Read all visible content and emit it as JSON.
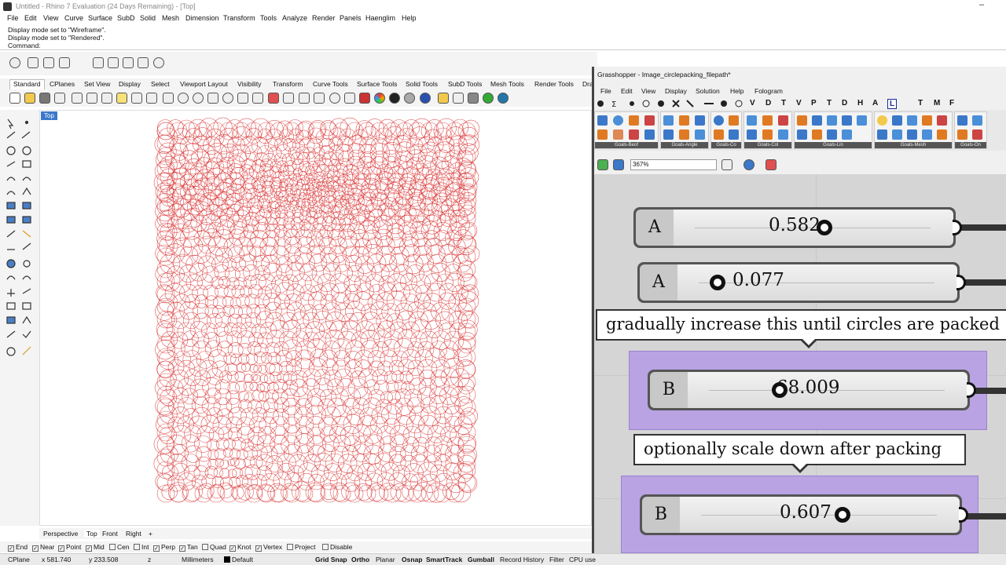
{
  "window": {
    "title": "Untitled - Rhino 7 Evaluation (24 Days Remaining) - [Top]",
    "minimize_glyph": "–"
  },
  "menubar": [
    "File",
    "Edit",
    "View",
    "Curve",
    "Surface",
    "SubD",
    "Solid",
    "Mesh",
    "Dimension",
    "Transform",
    "Tools",
    "Analyze",
    "Render",
    "Panels",
    "Haenglim",
    "Help"
  ],
  "command_history": {
    "line1": "Display mode set to \"Wireframe\".",
    "line2": "Display mode set to \"Rendered\".",
    "prompt": "Command:"
  },
  "toolbar_tabs": [
    "Standard",
    "CPlanes",
    "Set View",
    "Display",
    "Select",
    "Viewport Layout",
    "Visibility",
    "Transform",
    "Curve Tools",
    "Surface Tools",
    "Solid Tools",
    "SubD Tools",
    "Mesh Tools",
    "Render Tools",
    "Dra"
  ],
  "viewport": {
    "label": "Top",
    "tabs": [
      "Perspective",
      "Top",
      "Front",
      "Right"
    ],
    "add_tab_glyph": "+",
    "curve_color": "#d62020"
  },
  "osnaps": [
    {
      "label": "End",
      "checked": true
    },
    {
      "label": "Near",
      "checked": true
    },
    {
      "label": "Point",
      "checked": true
    },
    {
      "label": "Mid",
      "checked": true
    },
    {
      "label": "Cen",
      "checked": false
    },
    {
      "label": "Int",
      "checked": false
    },
    {
      "label": "Perp",
      "checked": true
    },
    {
      "label": "Tan",
      "checked": true
    },
    {
      "label": "Quad",
      "checked": false
    },
    {
      "label": "Knot",
      "checked": true
    },
    {
      "label": "Vertex",
      "checked": true
    },
    {
      "label": "Project",
      "checked": false
    },
    {
      "label": "Disable",
      "checked": false
    }
  ],
  "status": {
    "cplane": "CPlane",
    "x": "x 581.740",
    "y": "y 233.508",
    "z": "z",
    "units": "Millimeters",
    "layer": "Default",
    "grid_snap": "Grid Snap",
    "ortho": "Ortho",
    "planar": "Planar",
    "osnap": "Osnap",
    "smarttrack": "SmartTrack",
    "gumball": "Gumball",
    "record_history": "Record History",
    "filter": "Filter",
    "cpu": "CPU use"
  },
  "grasshopper": {
    "title": "Grasshopper - Image_circlepacking_filepath*",
    "menu": [
      "File",
      "Edit",
      "View",
      "Display",
      "Solution",
      "Help",
      "Fologram"
    ],
    "component_letters": [
      "V",
      "D",
      "T",
      "V",
      "P",
      "T",
      "D",
      "H",
      "A",
      "L",
      "T",
      "M",
      "F"
    ],
    "ribbon_groups": [
      "Goals-Beof",
      "Goals-Angle",
      "Goals-Co",
      "Goals-Col",
      "Goals-Lin",
      "Goals-Mesh",
      "Goals-On"
    ],
    "zoom": "367%",
    "sliders": [
      {
        "letter": "A",
        "value": "0.582",
        "fraction": 0.55
      },
      {
        "letter": "A",
        "value": "0.077",
        "fraction": 0.08
      },
      {
        "letter": "B",
        "value": "68.009",
        "fraction": 0.3
      },
      {
        "letter": "B",
        "value": "0.607",
        "fraction": 0.6
      }
    ],
    "panels": [
      "gradually increase this until circles are packed",
      "optionally scale down after packing"
    ],
    "group_color": "#b9a3e3",
    "canvas_color": "#d5d5d5"
  }
}
